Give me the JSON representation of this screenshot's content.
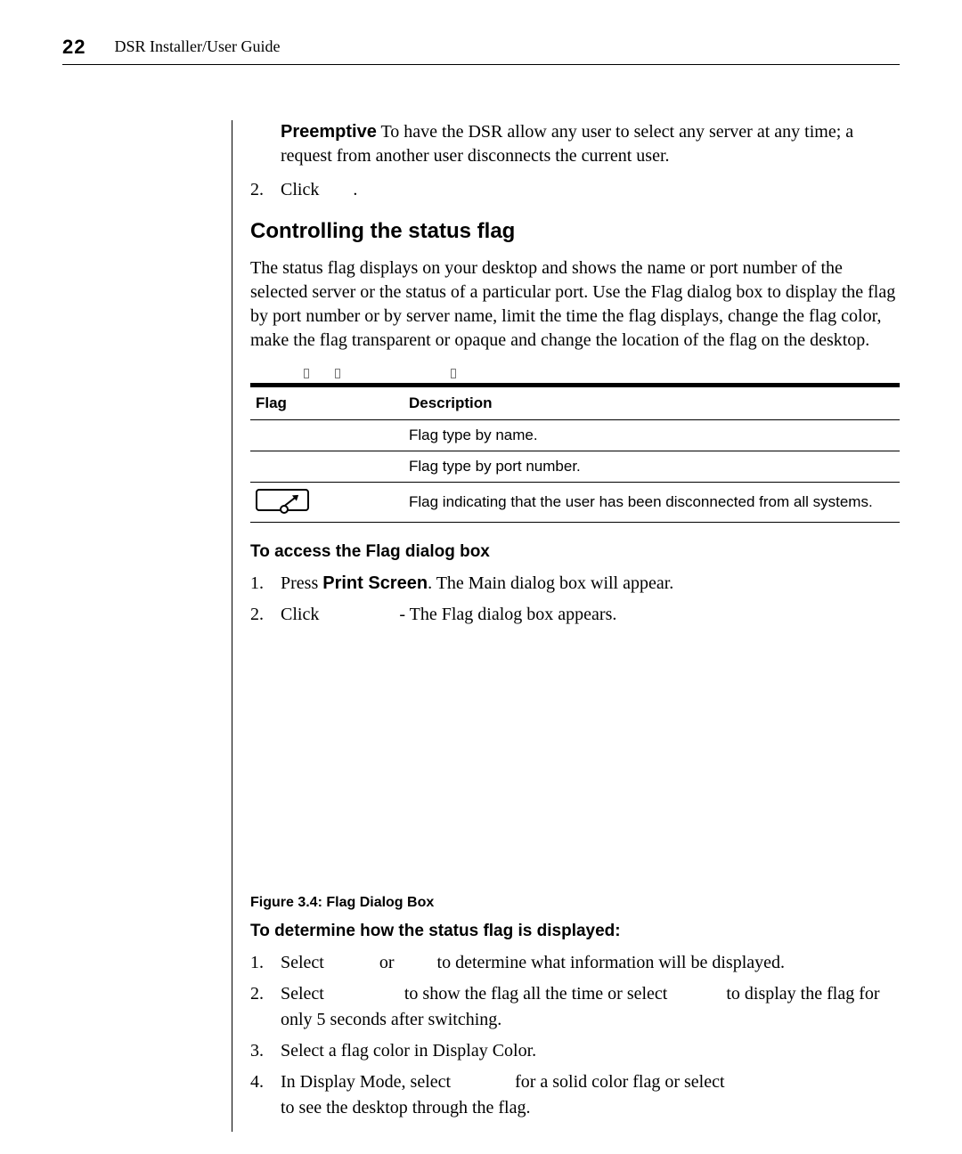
{
  "header": {
    "page_number": "22",
    "doc_title": "DSR Installer/User Guide"
  },
  "intro_block": {
    "bold_lead": "Preemptive",
    "lead_rest": " To have the DSR allow any user to select any server at any time; a request from another user disconnects the current user."
  },
  "step2_intro": {
    "num": "2.",
    "text_a": "Click ",
    "text_b": "."
  },
  "section_heading": "Controlling the status flag",
  "section_para": "The status flag displays on your desktop and shows the name or port number of the selected server or the status of a particular port. Use the Flag dialog box to display the flag by port number or by server name, limit the time the flag displays, change the flag color, make the flag transparent or opaque and change the location of the flag on the desktop.",
  "table": {
    "headers": {
      "flag": "Flag",
      "desc": "Description"
    },
    "rows": [
      {
        "flag": "",
        "desc": "Flag type by name."
      },
      {
        "flag": "",
        "desc": "Flag type by port number."
      },
      {
        "flag": "icon",
        "desc": "Flag indicating that the user has been disconnected from all systems."
      }
    ]
  },
  "access_heading": "To access the Flag dialog box",
  "access_steps": [
    {
      "num": "1.",
      "pre": "Press ",
      "bold": "Print Screen",
      "post": ". The Main dialog box will appear."
    },
    {
      "num": "2.",
      "pre": "Click ",
      "post": "- The Flag dialog box appears."
    }
  ],
  "figure_caption": "Figure 3.4:  Flag Dialog Box",
  "determine_heading": "To determine how the status flag is displayed:",
  "determine_steps": [
    {
      "num": "1.",
      "a": "Select ",
      "b": "or ",
      "c": "to determine what information will be displayed."
    },
    {
      "num": "2.",
      "a": "Select ",
      "b": "to show the flag all the time or select ",
      "c": "to display the flag for only 5 seconds after switching."
    },
    {
      "num": "3.",
      "a": "Select a flag color in Display Color."
    },
    {
      "num": "4.",
      "a": "In Display Mode, select ",
      "b": "for a solid color flag or select ",
      "c": "to see the desktop through the flag."
    }
  ]
}
